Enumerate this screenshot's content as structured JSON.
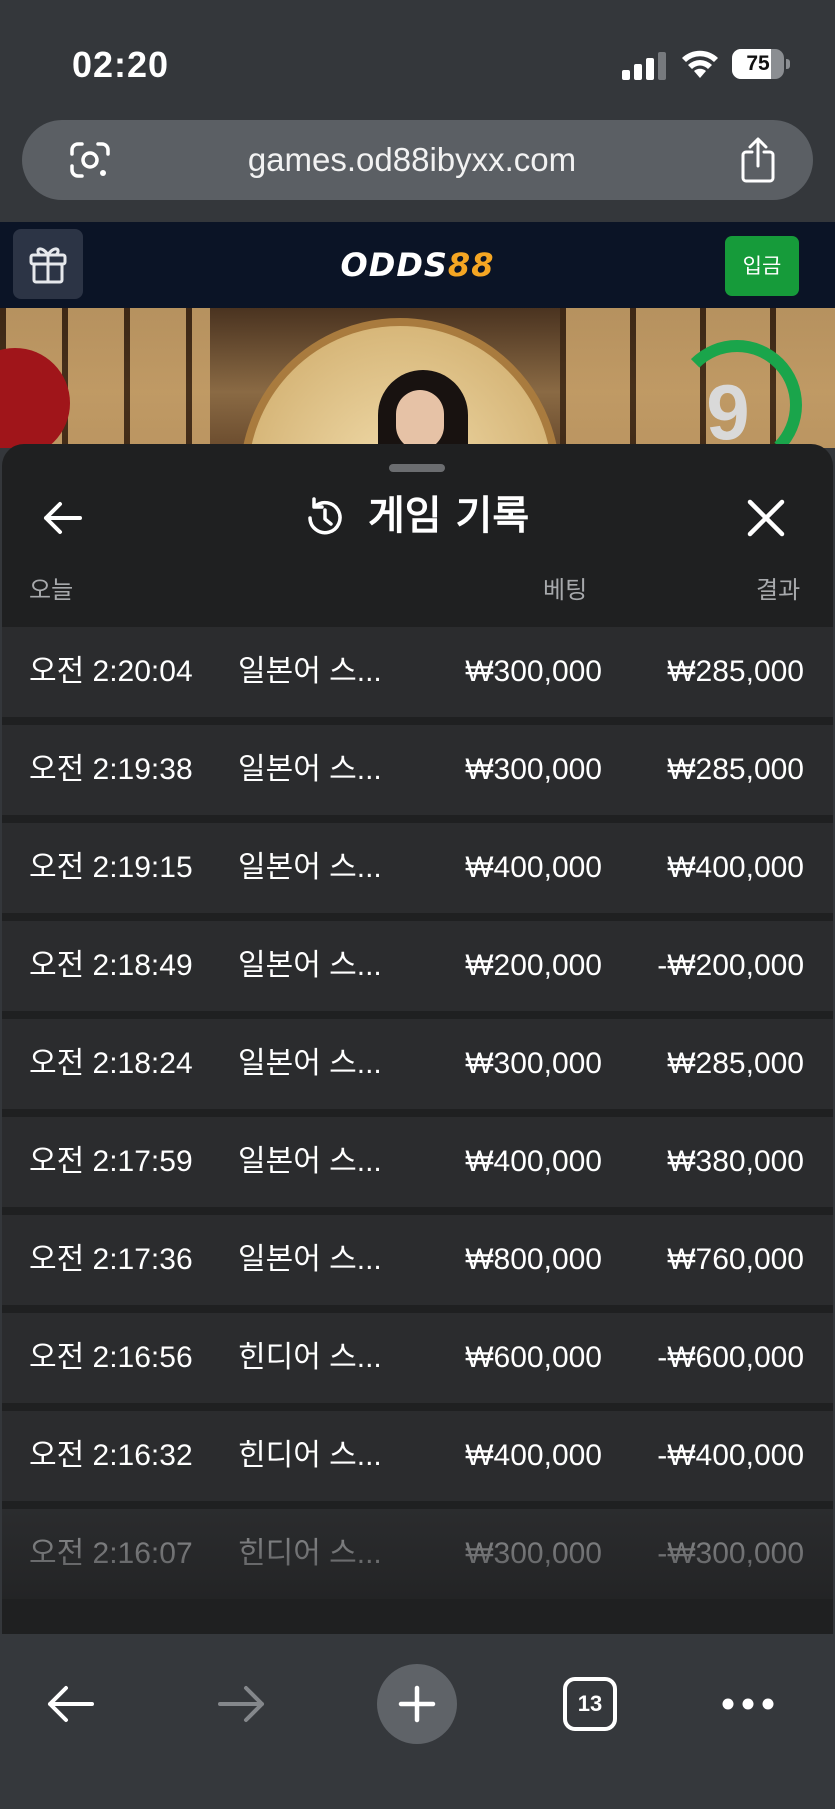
{
  "status_bar": {
    "time": "02:20",
    "battery": "75",
    "battery_level": 0.75
  },
  "browser": {
    "url": "games.od88ibyxx.com",
    "tab_count": "13"
  },
  "site_header": {
    "logo_white": "ODDS",
    "logo_yellow": "88",
    "deposit_label": "입금"
  },
  "video": {
    "timer_value": "9"
  },
  "sheet": {
    "title": "게임 기록",
    "columns": {
      "date": "오늘",
      "bet": "베팅",
      "result": "결과"
    },
    "rows": [
      {
        "time": "오전 2:20:04",
        "game": "일본어 스...",
        "bet": "₩300,000",
        "result": "₩285,000"
      },
      {
        "time": "오전 2:19:38",
        "game": "일본어 스...",
        "bet": "₩300,000",
        "result": "₩285,000"
      },
      {
        "time": "오전 2:19:15",
        "game": "일본어 스...",
        "bet": "₩400,000",
        "result": "₩400,000"
      },
      {
        "time": "오전 2:18:49",
        "game": "일본어 스...",
        "bet": "₩200,000",
        "result": "-₩200,000"
      },
      {
        "time": "오전 2:18:24",
        "game": "일본어 스...",
        "bet": "₩300,000",
        "result": "₩285,000"
      },
      {
        "time": "오전 2:17:59",
        "game": "일본어 스...",
        "bet": "₩400,000",
        "result": "₩380,000"
      },
      {
        "time": "오전 2:17:36",
        "game": "일본어 스...",
        "bet": "₩800,000",
        "result": "₩760,000"
      },
      {
        "time": "오전 2:16:56",
        "game": "힌디어 스...",
        "bet": "₩600,000",
        "result": "-₩600,000"
      },
      {
        "time": "오전 2:16:32",
        "game": "힌디어 스...",
        "bet": "₩400,000",
        "result": "-₩400,000"
      },
      {
        "time": "오전 2:16:07",
        "game": "힌디어 스...",
        "bet": "₩300,000",
        "result": "-₩300,000"
      }
    ]
  },
  "colors": {
    "deposit_green": "#169b3a",
    "logo_yellow": "#f5a623",
    "timer_green": "#1aa54b",
    "header_navy": "#0b1426"
  }
}
